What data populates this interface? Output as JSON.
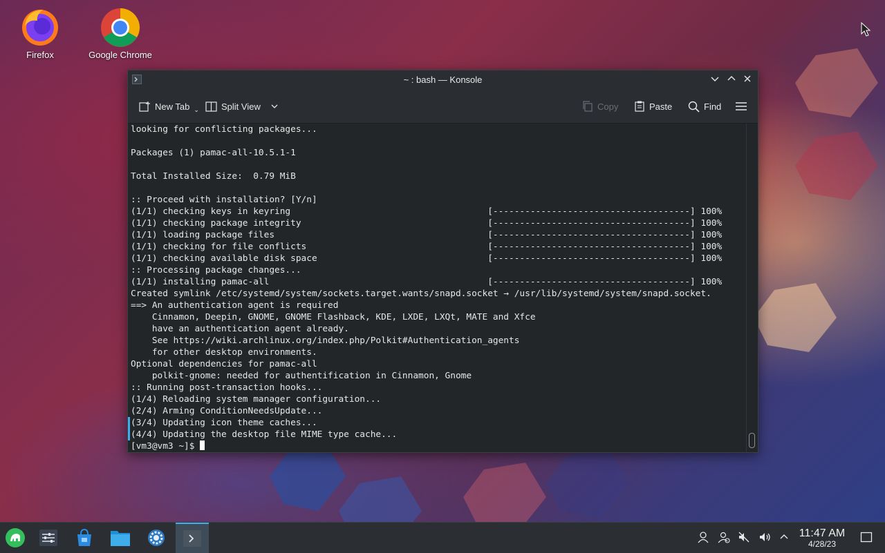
{
  "desktop": {
    "icons": [
      {
        "label": "Firefox",
        "icon": "firefox-icon"
      },
      {
        "label": "Google Chrome",
        "icon": "chrome-icon"
      }
    ]
  },
  "window": {
    "title": "~ : bash — Konsole",
    "toolbar": {
      "new_tab": "New Tab",
      "split_view": "Split View",
      "copy": "Copy",
      "paste": "Paste",
      "find": "Find"
    },
    "terminal_lines": [
      "looking for conflicting packages...",
      "",
      "Packages (1) pamac-all-10.5.1-1",
      "",
      "Total Installed Size:  0.79 MiB",
      "",
      ":: Proceed with installation? [Y/n]",
      "(1/1) checking keys in keyring                                     [-------------------------------------] 100%",
      "(1/1) checking package integrity                                   [-------------------------------------] 100%",
      "(1/1) loading package files                                        [-------------------------------------] 100%",
      "(1/1) checking for file conflicts                                  [-------------------------------------] 100%",
      "(1/1) checking available disk space                                [-------------------------------------] 100%",
      ":: Processing package changes...",
      "(1/1) installing pamac-all                                         [-------------------------------------] 100%",
      "Created symlink /etc/systemd/system/sockets.target.wants/snapd.socket → /usr/lib/systemd/system/snapd.socket.",
      "==> An authentication agent is required",
      "    Cinnamon, Deepin, GNOME, GNOME Flashback, KDE, LXDE, LXQt, MATE and Xfce",
      "    have an authentication agent already.",
      "    See https://wiki.archlinux.org/index.php/Polkit#Authentication_agents",
      "    for other desktop environments.",
      "Optional dependencies for pamac-all",
      "    polkit-gnome: needed for authentification in Cinnamon, Gnome",
      ":: Running post-transaction hooks...",
      "(1/4) Reloading system manager configuration...",
      "(2/4) Arming ConditionNeedsUpdate...",
      "(3/4) Updating icon theme caches...",
      "(4/4) Updating the desktop file MIME type cache..."
    ],
    "prompt": "[vm3@vm3 ~]$ "
  },
  "taskbar": {
    "time": "11:47 AM",
    "date": "4/28/23"
  }
}
